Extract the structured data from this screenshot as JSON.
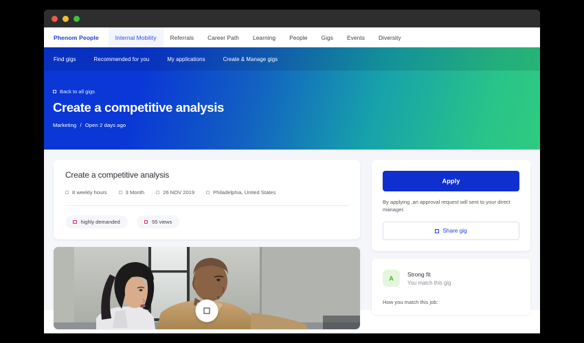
{
  "window": {
    "traffic_lights": [
      "close",
      "minimize",
      "maximize"
    ]
  },
  "topnav": {
    "brand": "Phenom People",
    "items": [
      {
        "label": "Internal Mobility",
        "active": true
      },
      {
        "label": "Referrals",
        "active": false
      },
      {
        "label": "Career Path",
        "active": false
      },
      {
        "label": "Learning",
        "active": false
      },
      {
        "label": "People",
        "active": false
      },
      {
        "label": "Gigs",
        "active": false
      },
      {
        "label": "Events",
        "active": false
      },
      {
        "label": "Diversity",
        "active": false
      }
    ]
  },
  "subnav": {
    "items": [
      {
        "label": "Find gigs"
      },
      {
        "label": "Recommended for you"
      },
      {
        "label": "My applications"
      },
      {
        "label": "Create & Manage gigs"
      }
    ]
  },
  "hero": {
    "back_label": "Back to all gigs",
    "back_icon": "chevron-left-icon",
    "title": "Create a competitive analysis",
    "category": "Marketing",
    "separator": "/",
    "status": "Open 2 days ago",
    "gradient_start": "#0a37d6",
    "gradient_end": "#2fcb81"
  },
  "job_card": {
    "title": "Create a competitive analysis",
    "meta": [
      {
        "icon": "clock-icon",
        "label": "8 weekly hours"
      },
      {
        "icon": "calendar-icon",
        "label": "3 Month"
      },
      {
        "icon": "date-icon",
        "label": "26 NOV 2019"
      },
      {
        "icon": "location-pin-icon",
        "label": "Philadelphia, United States"
      }
    ],
    "tags": [
      {
        "icon": "fire-icon",
        "label": "highly demanded",
        "color": "#e4277f"
      },
      {
        "icon": "eye-icon",
        "label": "55 views",
        "color": "#e4277f"
      }
    ]
  },
  "media": {
    "play_icon": "play-button-icon",
    "alt": "Two colleagues collaborating at a desk near an office window"
  },
  "apply_card": {
    "apply_label": "Apply",
    "apply_color": "#0f2fcf",
    "note": "By applying ,an approval request will sent to your direct manager.",
    "share_label": "Share gig",
    "share_icon": "share-icon"
  },
  "fit_card": {
    "avatar_initial": "A",
    "avatar_bg": "#e4f7de",
    "avatar_color": "#47b320",
    "title": "Strong fit",
    "subtitle": "You match this gig",
    "footer": "How you match this job:"
  }
}
